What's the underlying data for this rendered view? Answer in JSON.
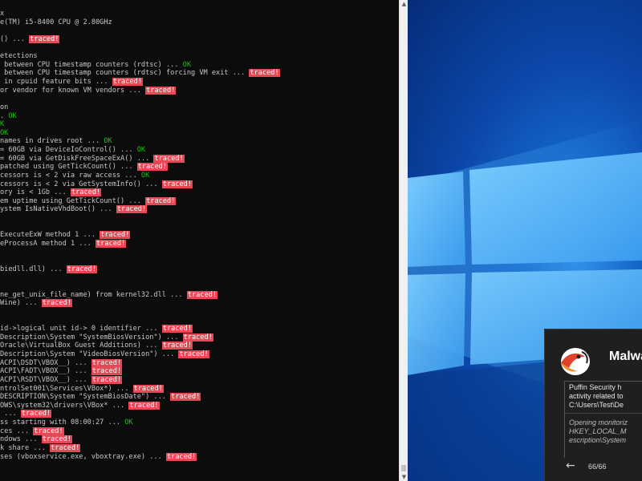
{
  "console": {
    "lines": [
      [
        {
          "t": "x"
        }
      ],
      [
        {
          "t": "e(TM) i5-8400 CPU @ 2.80GHz"
        }
      ],
      [],
      [
        {
          "t": "() ... "
        },
        {
          "t": "traced!",
          "k": "tr"
        }
      ],
      [],
      [
        {
          "t": "etections"
        }
      ],
      [
        {
          "t": " between CPU timestamp counters (rdtsc) ... "
        },
        {
          "t": "OK",
          "k": "ok"
        }
      ],
      [
        {
          "t": " between CPU timestamp counters (rdtsc) forcing VM exit ... "
        },
        {
          "t": "traced!",
          "k": "tr"
        }
      ],
      [
        {
          "t": " in cpuid feature bits ... "
        },
        {
          "t": "traced!",
          "k": "tr"
        }
      ],
      [
        {
          "t": "or vendor for known VM vendors ... "
        },
        {
          "t": "traced!",
          "k": "tr"
        }
      ],
      [],
      [
        {
          "t": "on"
        }
      ],
      [
        {
          "t": ". "
        },
        {
          "t": "OK",
          "k": "ok"
        }
      ],
      [
        {
          "t": "K",
          "k": "ok"
        }
      ],
      [
        {
          "t": "OK",
          "k": "ok"
        }
      ],
      [
        {
          "t": "names in drives root ... "
        },
        {
          "t": "OK",
          "k": "ok"
        }
      ],
      [
        {
          "t": "= 60GB via DeviceIoControl() ... "
        },
        {
          "t": "OK",
          "k": "ok"
        }
      ],
      [
        {
          "t": "= 60GB via GetDiskFreeSpaceExA() ... "
        },
        {
          "t": "traced!",
          "k": "tr"
        }
      ],
      [
        {
          "t": "patched using GetTickCount() ... "
        },
        {
          "t": "traced!",
          "k": "tr"
        }
      ],
      [
        {
          "t": "cessors is < 2 via raw access ... "
        },
        {
          "t": "OK",
          "k": "ok"
        }
      ],
      [
        {
          "t": "cessors is < 2 via GetSystemInfo() ... "
        },
        {
          "t": "traced!",
          "k": "tr"
        }
      ],
      [
        {
          "t": "ory is < 1Gb ... "
        },
        {
          "t": "traced!",
          "k": "tr"
        }
      ],
      [
        {
          "t": "em uptime using GetTickCount() ... "
        },
        {
          "t": "traced!",
          "k": "tr"
        }
      ],
      [
        {
          "t": "ystem IsNativeVhdBoot() ... "
        },
        {
          "t": "traced!",
          "k": "tr"
        }
      ],
      [],
      [],
      [
        {
          "t": "ExecuteExW method 1 ... "
        },
        {
          "t": "traced!",
          "k": "tr"
        }
      ],
      [
        {
          "t": "eProcessA method 1 ... "
        },
        {
          "t": "traced!",
          "k": "tr"
        }
      ],
      [],
      [],
      [
        {
          "t": "biedll.dll) ... "
        },
        {
          "t": "traced!",
          "k": "tr"
        }
      ],
      [],
      [],
      [
        {
          "t": "ne_get_unix_file_name) from kernel32.dll ... "
        },
        {
          "t": "traced!",
          "k": "tr"
        }
      ],
      [
        {
          "t": "Wine) ... "
        },
        {
          "t": "traced!",
          "k": "tr"
        }
      ],
      [],
      [],
      [
        {
          "t": "id->logical unit id-> 0 identifier ... "
        },
        {
          "t": "traced!",
          "k": "tr"
        }
      ],
      [
        {
          "t": "Description\\System \"SystemBiosVersion\") ... "
        },
        {
          "t": "traced!",
          "k": "tr"
        }
      ],
      [
        {
          "t": "Oracle\\VirtualBox Guest Additions) ... "
        },
        {
          "t": "traced!",
          "k": "tr"
        }
      ],
      [
        {
          "t": "Description\\System \"VideoBiosVersion\") ... "
        },
        {
          "t": "traced!",
          "k": "tr"
        }
      ],
      [
        {
          "t": "ACPI\\DSDT\\VBOX__) ... "
        },
        {
          "t": "traced!",
          "k": "tr"
        }
      ],
      [
        {
          "t": "ACPI\\FADT\\VBOX__) ... "
        },
        {
          "t": "traced!",
          "k": "tr"
        }
      ],
      [
        {
          "t": "ACPI\\RSDT\\VBOX__) ... "
        },
        {
          "t": "traced!",
          "k": "tr"
        }
      ],
      [
        {
          "t": "ntrolSet001\\Services\\VBox*) ... "
        },
        {
          "t": "traced!",
          "k": "tr"
        }
      ],
      [
        {
          "t": "DESCRIPTION\\System \"SystemBiosDate\") ... "
        },
        {
          "t": "traced!",
          "k": "tr"
        }
      ],
      [
        {
          "t": "OWS\\system32\\drivers\\VBox* ... "
        },
        {
          "t": "traced!",
          "k": "tr"
        }
      ],
      [
        {
          "t": " ... "
        },
        {
          "t": "traced!",
          "k": "tr"
        }
      ],
      [
        {
          "t": "ss starting with 08:00:27 ... "
        },
        {
          "t": "OK",
          "k": "ok"
        }
      ],
      [
        {
          "t": "ces ... "
        },
        {
          "t": "traced!",
          "k": "tr"
        }
      ],
      [
        {
          "t": "ndows ... "
        },
        {
          "t": "traced!",
          "k": "tr"
        }
      ],
      [
        {
          "t": "k share ... "
        },
        {
          "t": "traced!",
          "k": "tr"
        }
      ],
      [
        {
          "t": "ses (vboxservice.exe, vboxtray.exe) ... "
        },
        {
          "t": "traced!",
          "k": "tr"
        }
      ]
    ]
  },
  "colors": {
    "console_bg": "#0c0c0c",
    "console_text": "#c8c8c8",
    "ok": "#16c60c",
    "traced_bg": "#e74856",
    "toast_bg": "#1f1f1f"
  },
  "toast": {
    "icon": "puffin-logo-icon",
    "title": "Malwa",
    "body_lines": [
      "Puffin Security h",
      "activity related to",
      "C:\\Users\\Test\\De"
    ],
    "sub_lines": [
      "Opening monitoriz",
      "HKEY_LOCAL_M",
      "escription\\System"
    ],
    "counter": "66/66",
    "back_icon": "arrow-left-icon"
  }
}
